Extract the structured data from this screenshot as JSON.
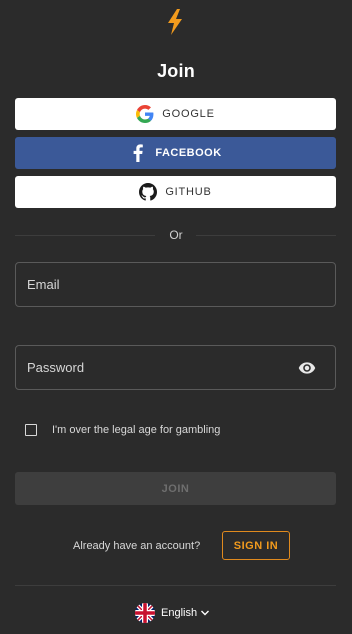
{
  "header": {
    "title": "Join"
  },
  "social": {
    "google_label": "GOOGLE",
    "facebook_label": "FACEBOOK",
    "github_label": "GITHUB"
  },
  "divider": {
    "text": "Or"
  },
  "form": {
    "email": {
      "placeholder": "Email",
      "value": ""
    },
    "password": {
      "placeholder": "Password",
      "value": ""
    },
    "age_checkbox": {
      "label": "I'm over the legal age for gambling",
      "checked": false
    },
    "join_label": "JOIN"
  },
  "footer": {
    "already_text": "Already have an account?",
    "signin_label": "SIGN IN",
    "language": "English"
  },
  "icons": {
    "logo": "lightning-bolt-icon",
    "google": "google-icon",
    "facebook": "facebook-icon",
    "github": "github-icon",
    "password_toggle": "eye-icon",
    "flag": "uk-flag-icon",
    "language_dropdown": "chevron-down-icon"
  },
  "colors": {
    "background": "#2b2b2b",
    "accent": "#f29b1d",
    "facebook": "#3b5998",
    "join_disabled": "#3e3e3e"
  }
}
